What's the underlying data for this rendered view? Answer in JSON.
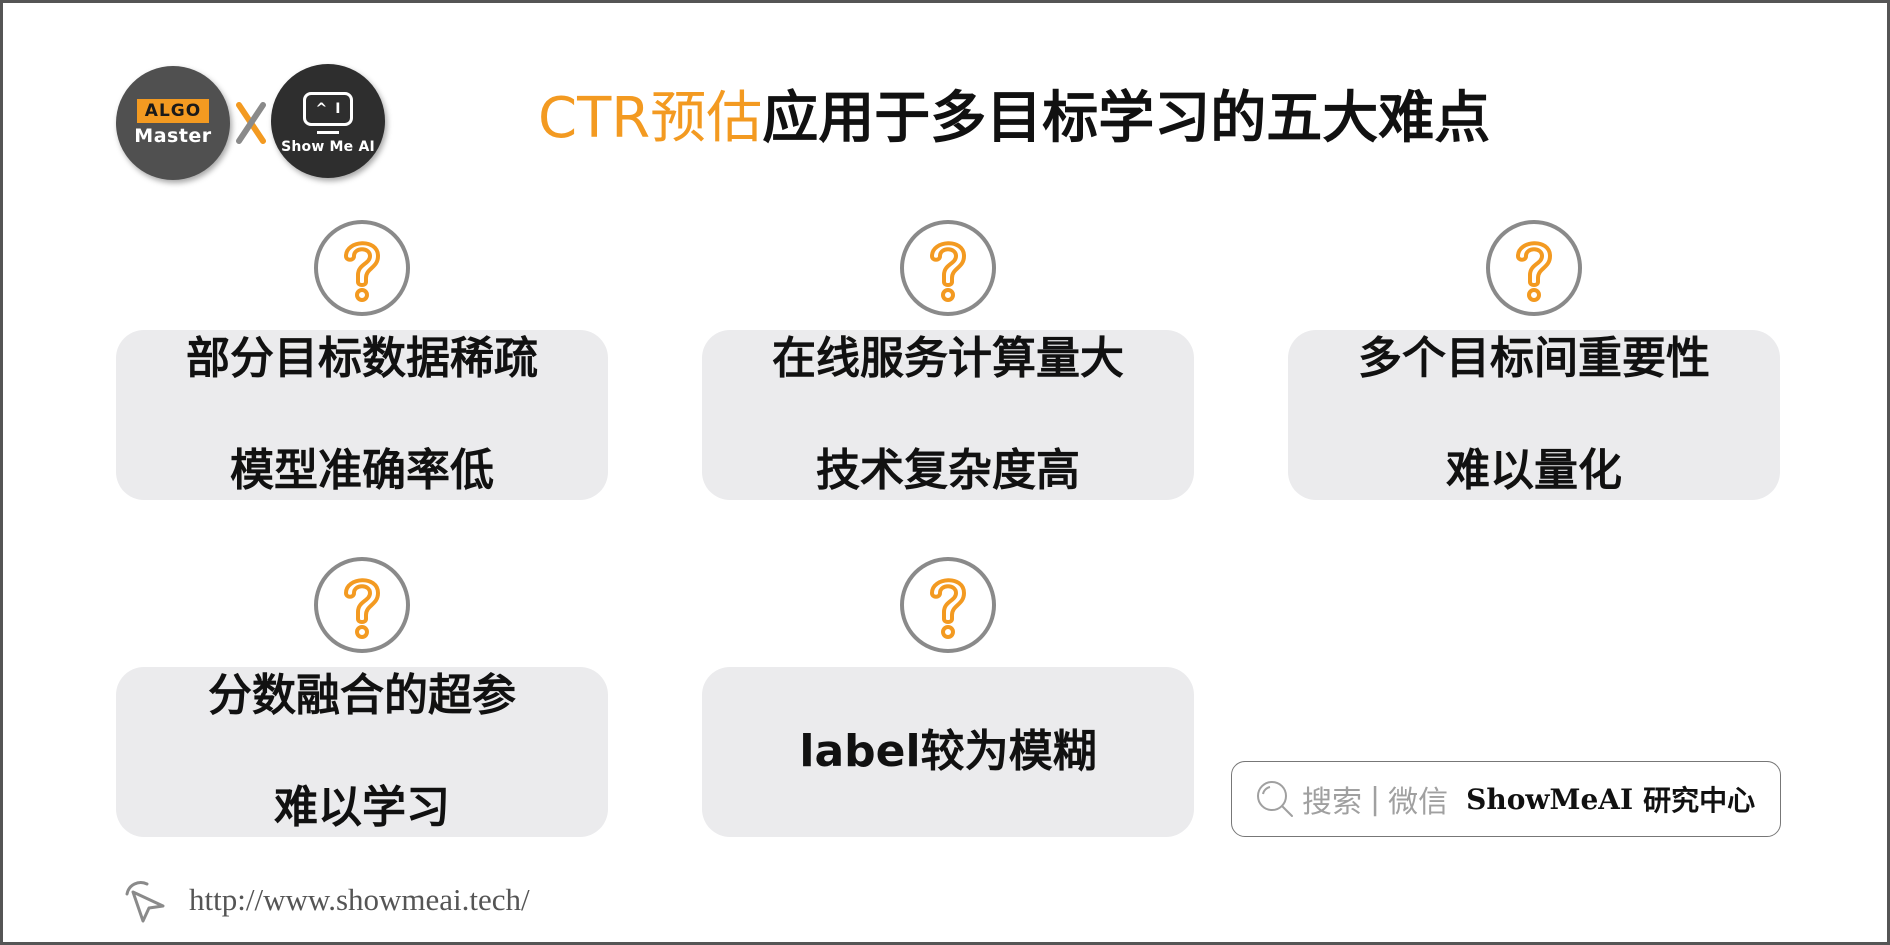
{
  "colors": {
    "accent": "#f39a21",
    "card_bg": "#ebebed",
    "circle_ring": "#8a8a8a",
    "frame_border": "#555555"
  },
  "logos": {
    "algo_tag": "ALGO",
    "algo_name": "Master",
    "separator": "X",
    "showme_screen_left": "^",
    "showme_screen_right": "I",
    "showme_name": "Show Me AI"
  },
  "title": {
    "accent_part": "CTR预估",
    "main_part": "应用于多目标学习的五大难点"
  },
  "challenges": [
    {
      "icon": "question-mark-icon",
      "lines": [
        "部分目标数据稀疏",
        "模型准确率低"
      ]
    },
    {
      "icon": "question-mark-icon",
      "lines": [
        "在线服务计算量大",
        "技术复杂度高"
      ]
    },
    {
      "icon": "question-mark-icon",
      "lines": [
        "多个目标间重要性",
        "难以量化"
      ]
    },
    {
      "icon": "question-mark-icon",
      "lines": [
        "分数融合的超参",
        "难以学习"
      ]
    },
    {
      "icon": "question-mark-icon",
      "lines": [
        "label较为模糊"
      ]
    }
  ],
  "search_box": {
    "icon": "search-icon",
    "label_search": "搜索",
    "divider": "|",
    "label_wechat": "微信",
    "brand": "ShowMeAI",
    "brand_suffix": "研究中心"
  },
  "footer": {
    "icon": "cursor-click-icon",
    "url": "http://www.showmeai.tech/"
  }
}
